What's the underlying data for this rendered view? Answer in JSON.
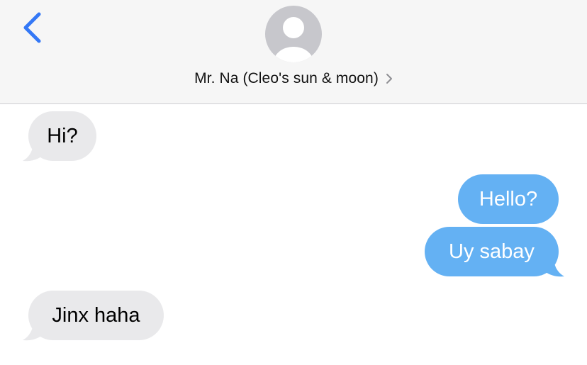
{
  "header": {
    "back_icon": "chevron-left-icon",
    "avatar_icon": "person-silhouette-icon",
    "contact_name": "Mr. Na (Cleo's sun & moon)",
    "details_icon": "chevron-right-icon"
  },
  "colors": {
    "accent": "#3478f6",
    "incoming_bubble": "#e9e9eb",
    "outgoing_bubble": "#64b1f3",
    "header_bg": "#f6f6f6"
  },
  "messages": [
    {
      "direction": "incoming",
      "text": "Hi?"
    },
    {
      "direction": "outgoing",
      "text": "Hello?"
    },
    {
      "direction": "outgoing",
      "text": "Uy sabay"
    },
    {
      "direction": "incoming",
      "text": "Jinx haha"
    }
  ]
}
